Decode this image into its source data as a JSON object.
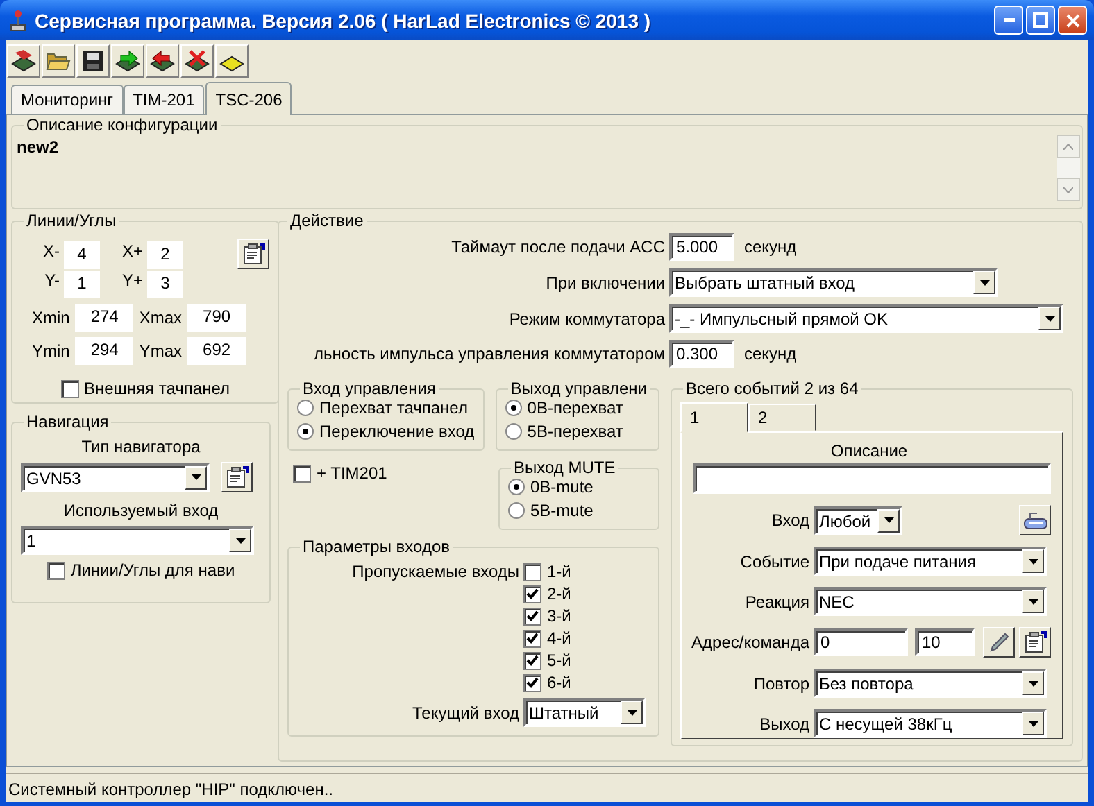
{
  "window": {
    "title": "Сервисная программа. Версия 2.06 ( HarLad Electronics © 2013 )"
  },
  "toolbar": [
    {
      "kind": "chip-stack"
    },
    {
      "kind": "folder"
    },
    {
      "kind": "floppy"
    },
    {
      "kind": "chip-in"
    },
    {
      "kind": "chip-out"
    },
    {
      "kind": "chip-delete"
    },
    {
      "kind": "chip-blank"
    }
  ],
  "tabs": [
    {
      "label": "Мониторинг",
      "selected": false
    },
    {
      "label": "TIM-201",
      "selected": false
    },
    {
      "label": "TSC-206",
      "selected": true
    }
  ],
  "config_description": {
    "title": "Описание конфигурации",
    "value": "new2"
  },
  "lines_angles": {
    "title": "Линии/Углы",
    "offsets": [
      {
        "label": "X-",
        "value": "4"
      },
      {
        "label": "X+",
        "value": "2"
      },
      {
        "label": "Y-",
        "value": "1"
      },
      {
        "label": "Y+",
        "value": "3"
      }
    ],
    "limits": [
      {
        "label": "Xmin",
        "value": "274"
      },
      {
        "label": "Xmax",
        "value": "790"
      },
      {
        "label": "Ymin",
        "value": "294"
      },
      {
        "label": "Ymax",
        "value": "692"
      }
    ],
    "external_touchpanel": {
      "label": "Внешняя тачпанел",
      "checked": false
    }
  },
  "navigation": {
    "title": "Навигация",
    "type_label": "Тип навигатора",
    "type_value": "GVN53",
    "input_label": "Используемый вход",
    "input_value": "1",
    "lines_for_nav": {
      "label": "Линии/Углы для нави",
      "checked": false
    }
  },
  "action": {
    "title": "Действие",
    "rows": [
      {
        "kind": "number",
        "label": "Таймаут после подачи ACC",
        "value": "5.000",
        "unit": "секунд"
      },
      {
        "kind": "select-short",
        "label": "При включении",
        "value": "Выбрать штатный вход"
      },
      {
        "kind": "select-long",
        "label": "Режим коммутатора",
        "value": "-_- Импульсный прямой OK"
      },
      {
        "kind": "number",
        "label": "льность импульса управления коммутатором",
        "value": "0.300",
        "unit": "секунд"
      }
    ],
    "control_input": {
      "title": "Вход управления",
      "options": [
        {
          "label": "Перехват тачпанел",
          "selected": false
        },
        {
          "label": "Переключение вход",
          "selected": true
        }
      ]
    },
    "control_output": {
      "title": "Выход управлени",
      "options": [
        {
          "label": "0В-перехват",
          "selected": true
        },
        {
          "label": "5В-перехват",
          "selected": false
        }
      ]
    },
    "tim201": {
      "label": "+ TIM201",
      "checked": false
    },
    "mute_output": {
      "title": "Выход MUTE",
      "options": [
        {
          "label": "0В-mute",
          "selected": true
        },
        {
          "label": "5В-mute",
          "selected": false
        }
      ]
    },
    "input_params": {
      "title": "Параметры входов",
      "skipped_label": "Пропускаемые входы",
      "skipped_inputs": [
        {
          "label": "1-й",
          "checked": false
        },
        {
          "label": "2-й",
          "checked": true
        },
        {
          "label": "3-й",
          "checked": true
        },
        {
          "label": "4-й",
          "checked": true
        },
        {
          "label": "5-й",
          "checked": true
        },
        {
          "label": "6-й",
          "checked": true
        }
      ],
      "current_label": "Текущий вход",
      "current_value": "Штатный"
    },
    "events": {
      "title": "Всего событий 2 из 64",
      "tabs": [
        {
          "label": "1",
          "selected": true
        },
        {
          "label": "2",
          "selected": false
        }
      ],
      "description_label": "Описание",
      "rows": [
        {
          "kind": "select-short",
          "label": "Вход",
          "value": "Любой"
        },
        {
          "kind": "select",
          "label": "Событие",
          "value": "При подаче питания"
        },
        {
          "kind": "select",
          "label": "Реакция",
          "value": "NEC"
        },
        {
          "kind": "pair",
          "label": "Адрес/команда",
          "values": [
            "0",
            "10"
          ]
        },
        {
          "kind": "select",
          "label": "Повтор",
          "value": "Без повтора"
        },
        {
          "kind": "select",
          "label": "Выход",
          "value": "С несущей 38кГц"
        }
      ]
    }
  },
  "status_bar": {
    "text": "Системный контроллер \"HIP\" подключен.."
  }
}
